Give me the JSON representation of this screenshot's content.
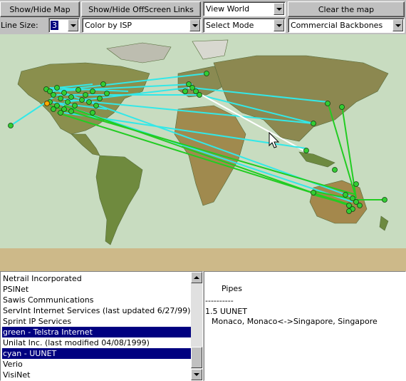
{
  "toolbar": {
    "show_hide_map": "Show/Hide Map",
    "show_hide_offscreen": "Show/Hide OffScreen Links",
    "view_select": "View World",
    "clear_map": "Clear the map"
  },
  "controls": {
    "line_size_label": "Line Size:",
    "line_size_value": "3",
    "color_by": "Color by ISP",
    "mode": "Select Mode",
    "backbones": "Commercial Backbones"
  },
  "isp_list": {
    "items": [
      {
        "label": "Netrail Incorporated",
        "selected": false
      },
      {
        "label": "PSINet",
        "selected": false
      },
      {
        "label": "Sawis Communications",
        "selected": false
      },
      {
        "label": "ServInt Internet Services (last updated 6/27/99)",
        "selected": false
      },
      {
        "label": "Sprint IP Services",
        "selected": false
      },
      {
        "label": "green - Telstra Internet",
        "selected": true
      },
      {
        "label": "Unilat Inc. (last modified 04/08/1999)",
        "selected": false
      },
      {
        "label": "cyan - UUNET",
        "selected": true
      },
      {
        "label": "Verio",
        "selected": false
      },
      {
        "label": "VisiNet",
        "selected": false
      }
    ]
  },
  "info_panel": {
    "heading": "Pipes",
    "divider": "----------",
    "pipe_entry": "1.5 UUNET",
    "pipe_route": "Monaco, Monaco<->Singapore, Singapore"
  },
  "colors": {
    "uunet": "#33e8e8",
    "telstra": "#22cc22",
    "selected_link": "#ffffff",
    "node": "#33cc33",
    "highlight_node": "#ffaa00",
    "ocean": "#c8dcc0"
  }
}
